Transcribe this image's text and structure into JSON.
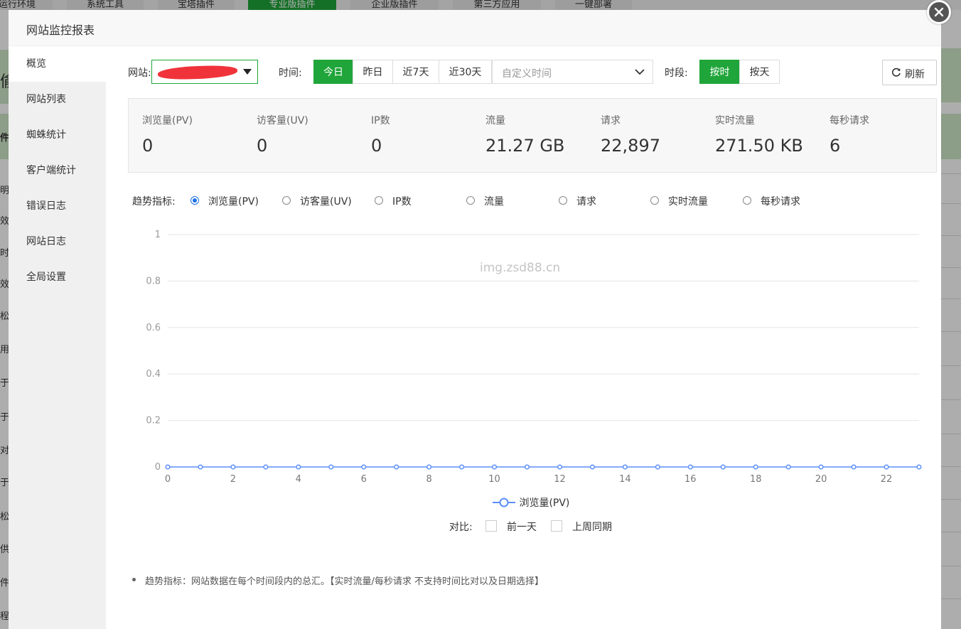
{
  "background": {
    "tabs": [
      "运行环境",
      "系统工具",
      "宝塔插件",
      "专业版插件",
      "企业版插件",
      "第三方应用",
      "一键部署"
    ],
    "left_fragments": [
      "偷",
      "件",
      "明",
      "效",
      "时",
      "效",
      "松",
      "用",
      "于",
      "于",
      "对",
      "于",
      "松",
      "供",
      "件",
      "程"
    ]
  },
  "modal": {
    "title": "网站监控报表",
    "close_icon": "close-icon"
  },
  "sidebar": {
    "items": [
      {
        "label": "概览",
        "active": true
      },
      {
        "label": "网站列表"
      },
      {
        "label": "蜘蛛统计"
      },
      {
        "label": "客户端统计"
      },
      {
        "label": "错误日志"
      },
      {
        "label": "网站日志"
      },
      {
        "label": "全局设置"
      }
    ]
  },
  "filters": {
    "site_label": "网站:",
    "time_label": "时间:",
    "time_buttons": [
      "今日",
      "昨日",
      "近7天",
      "近30天"
    ],
    "time_active": "今日",
    "custom_time_placeholder": "自定义时间",
    "period_label": "时段:",
    "period_buttons": [
      "按时",
      "按天"
    ],
    "period_active": "按时",
    "refresh_label": "刷新"
  },
  "stats": [
    {
      "label": "浏览量(PV)",
      "value": "0"
    },
    {
      "label": "访客量(UV)",
      "value": "0"
    },
    {
      "label": "IP数",
      "value": "0"
    },
    {
      "label": "流量",
      "value": "21.27 GB"
    },
    {
      "label": "请求",
      "value": "22,897"
    },
    {
      "label": "实时流量",
      "value": "271.50 KB"
    },
    {
      "label": "每秒请求",
      "value": "6"
    }
  ],
  "trend": {
    "label": "趋势指标:",
    "options": [
      "浏览量(PV)",
      "访客量(UV)",
      "IP数",
      "流量",
      "请求",
      "实时流量",
      "每秒请求"
    ],
    "selected": "浏览量(PV)"
  },
  "chart_data": {
    "type": "line",
    "x": [
      0,
      1,
      2,
      3,
      4,
      5,
      6,
      7,
      8,
      9,
      10,
      11,
      12,
      13,
      14,
      15,
      16,
      17,
      18,
      19,
      20,
      21,
      22,
      23
    ],
    "x_ticks": [
      0,
      2,
      4,
      6,
      8,
      10,
      12,
      14,
      16,
      18,
      20,
      22
    ],
    "series": [
      {
        "name": "浏览量(PV)",
        "values": [
          0,
          0,
          0,
          0,
          0,
          0,
          0,
          0,
          0,
          0,
          0,
          0,
          0,
          0,
          0,
          0,
          0,
          0,
          0,
          0,
          0,
          0,
          0,
          0
        ],
        "color": "#5b8ff9"
      }
    ],
    "ylim": [
      0,
      1
    ],
    "y_ticks": [
      0,
      0.2,
      0.4,
      0.6,
      0.8,
      1
    ],
    "grid": true,
    "legend": "bottom",
    "watermark": "img.zsd88.cn"
  },
  "compare": {
    "label": "对比:",
    "options": [
      "前一天",
      "上周同期"
    ]
  },
  "note": "趋势指标：网站数据在每个时间段内的总汇。【实时流量/每秒请求 不支持时间比对以及日期选择】",
  "colors": {
    "accent": "#20a53a",
    "line": "#5b8ff9",
    "radio": "#1e70e6"
  }
}
